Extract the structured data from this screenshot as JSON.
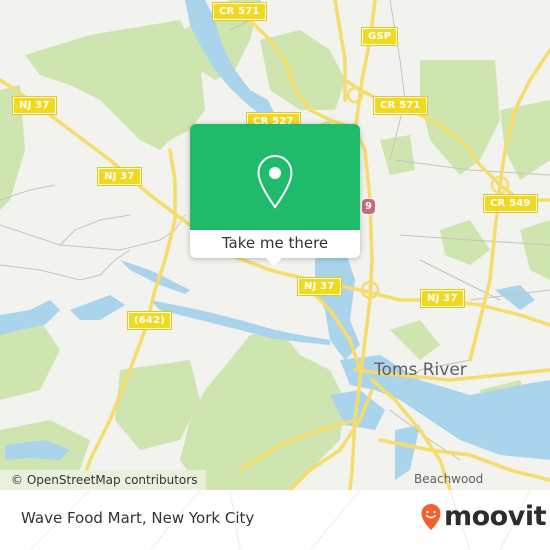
{
  "map": {
    "road_labels": [
      {
        "id": "cr571-north",
        "text": "CR 571",
        "kind": "county"
      },
      {
        "id": "gsp",
        "text": "GSP",
        "kind": "county"
      },
      {
        "id": "nj37-west",
        "text": "NJ 37",
        "kind": "state"
      },
      {
        "id": "cr527",
        "text": "CR 527",
        "kind": "county"
      },
      {
        "id": "cr571-east",
        "text": "CR 571",
        "kind": "county"
      },
      {
        "id": "nj37-mid",
        "text": "NJ 37",
        "kind": "state"
      },
      {
        "id": "us9",
        "text": "9",
        "kind": "us"
      },
      {
        "id": "cr549",
        "text": "CR 549",
        "kind": "county"
      },
      {
        "id": "nj37-center",
        "text": "NJ 37",
        "kind": "state"
      },
      {
        "id": "nj37-east",
        "text": "NJ 37",
        "kind": "state"
      },
      {
        "id": "cr642",
        "text": "(642)",
        "kind": "county"
      }
    ],
    "place_labels": [
      {
        "id": "toms-river",
        "text": "Toms River",
        "kind": "city"
      },
      {
        "id": "beachwood",
        "text": "Beachwood",
        "kind": "town"
      }
    ],
    "attribution": "© OpenStreetMap contributors",
    "colors": {
      "land": "#f2f2ee",
      "park": "#cfe5b0",
      "water": "#a9d4ec",
      "road": "#f6dc6a",
      "minor_road": "#c9c2bb",
      "popup_green": "#1fba6a"
    }
  },
  "popup": {
    "icon": "location-pin-icon",
    "button_label": "Take me there"
  },
  "footer": {
    "place_title": "Wave Food Mart, New York City",
    "brand": "moovit",
    "brand_color": "#f0612d"
  }
}
